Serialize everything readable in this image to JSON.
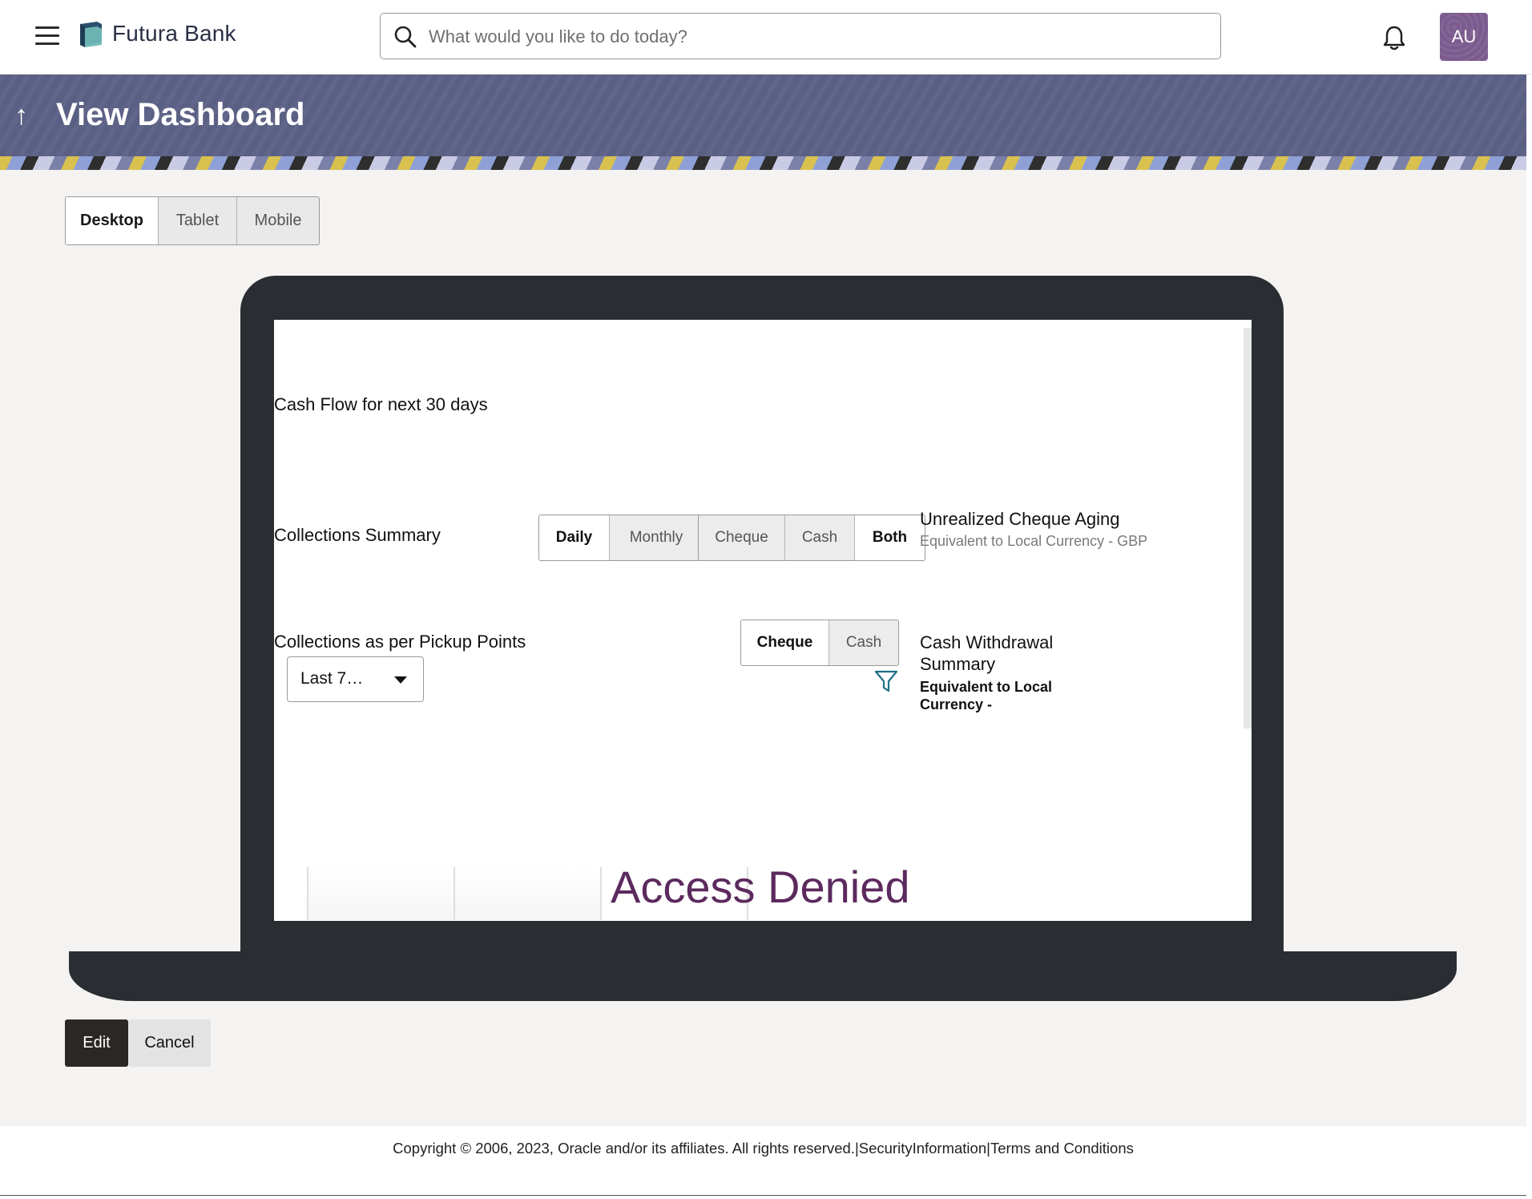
{
  "header": {
    "brand_name": "Futura Bank",
    "search_placeholder": "What would you like to do today?",
    "avatar_initials": "AU",
    "icons": [
      "hamburger-menu-icon",
      "bank-logo-icon",
      "search-icon",
      "bell-icon"
    ]
  },
  "banner": {
    "title": "View Dashboard",
    "back_icon": "↑"
  },
  "device_toggle": {
    "options": [
      "Desktop",
      "Tablet",
      "Mobile"
    ],
    "selected": "Desktop"
  },
  "preview": {
    "cash_flow_title": "Cash Flow for next 30 days",
    "collections_summary": {
      "title": "Collections Summary",
      "period_options": [
        "Daily",
        "Monthly"
      ],
      "period_selected": "Daily",
      "type_options": [
        "Cheque",
        "Cash",
        "Both"
      ],
      "type_selected": "Both"
    },
    "unrealized_cheque": {
      "title": "Unrealized Cheque Aging",
      "subtitle": "Equivalent to Local Currency - GBP"
    },
    "pickup_points": {
      "title": "Collections as per Pickup Points",
      "dropdown_value": "Last 7…",
      "type_options": [
        "Cheque",
        "Cash"
      ],
      "type_selected": "Cheque"
    },
    "cash_withdrawal": {
      "title_line1": "Cash Withdrawal",
      "title_line2": "Summary",
      "sub_line1": "Equivalent to Local",
      "sub_line2": "Currency -"
    },
    "access_denied": "Access Denied"
  },
  "actions": {
    "edit_label": "Edit",
    "cancel_label": "Cancel"
  },
  "footer": {
    "copyright": "Copyright © 2006, 2023, Oracle and/or its affiliates. All rights reserved.",
    "sep1": "|",
    "security_link": "SecurityInformation",
    "sep2": "|",
    "terms_link": "Terms and Conditions"
  },
  "colors": {
    "banner_bg": "#5a5f84",
    "avatar_bg": "#7b5a8e",
    "access_denied": "#5c2a5e",
    "laptop_frame": "#2a2d31",
    "edit_button": "#2b2725"
  }
}
